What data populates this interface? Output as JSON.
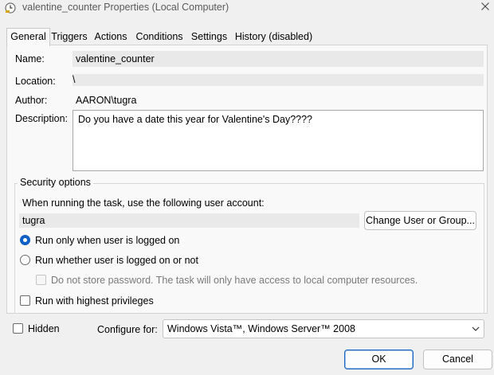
{
  "window": {
    "title": "valentine_counter Properties (Local Computer)"
  },
  "tabs": [
    {
      "label": "General"
    },
    {
      "label": "Triggers"
    },
    {
      "label": "Actions"
    },
    {
      "label": "Conditions"
    },
    {
      "label": "Settings"
    },
    {
      "label": "History (disabled)"
    }
  ],
  "general": {
    "name_label": "Name:",
    "name_value": "valentine_counter",
    "location_label": "Location:",
    "location_value": "\\",
    "author_label": "Author:",
    "author_value": "AARON\\tugra",
    "description_label": "Description:",
    "description_value": "Do you have a date this year for Valentine's Day????"
  },
  "security": {
    "group_title": "Security options",
    "account_prompt": "When running the task, use the following user account:",
    "account_value": "tugra",
    "change_button": "Change User or Group...",
    "radio_logged_on": "Run only when user is logged on",
    "radio_logged_on_checked": true,
    "radio_whether": "Run whether user is logged on or not",
    "no_store_password": "Do not store password.  The task will only have access to local computer resources.",
    "highest_privileges": "Run with highest privileges"
  },
  "footer": {
    "hidden_label": "Hidden",
    "configure_label": "Configure for:",
    "configure_value": "Windows Vista™, Windows Server™ 2008",
    "ok_button": "OK",
    "cancel_button": "Cancel"
  },
  "icons": {
    "title": "task-clock-icon",
    "close": "close-icon",
    "dropdown": "chevron-down-icon"
  },
  "colors": {
    "accent": "#0f5fc4",
    "window_bg": "#f0f0f0",
    "panel_bg": "#f9f9f9"
  }
}
